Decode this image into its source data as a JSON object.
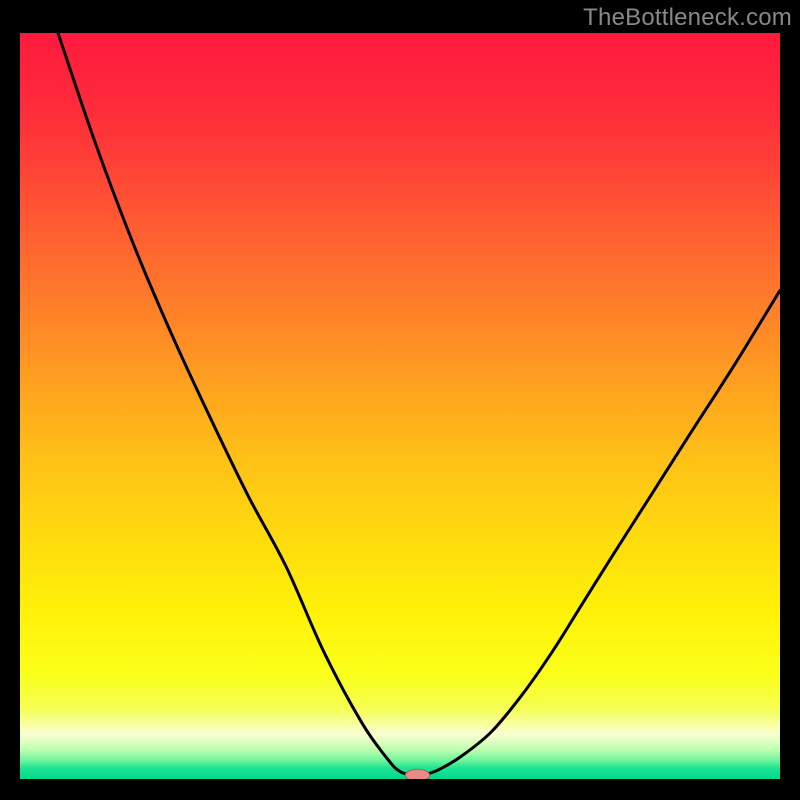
{
  "watermark": "TheBottleneck.com",
  "colors": {
    "gradient": [
      {
        "offset": 0.0,
        "color": "#ff1a3e"
      },
      {
        "offset": 0.1,
        "color": "#ff2b3a"
      },
      {
        "offset": 0.18,
        "color": "#ff4236"
      },
      {
        "offset": 0.28,
        "color": "#ff6330"
      },
      {
        "offset": 0.38,
        "color": "#ff8328"
      },
      {
        "offset": 0.48,
        "color": "#ffa41f"
      },
      {
        "offset": 0.58,
        "color": "#ffc316"
      },
      {
        "offset": 0.68,
        "color": "#ffdc0e"
      },
      {
        "offset": 0.78,
        "color": "#fff208"
      },
      {
        "offset": 0.86,
        "color": "#fbff1a"
      },
      {
        "offset": 0.905,
        "color": "#f5ff52"
      },
      {
        "offset": 0.94,
        "color": "#faffd1"
      },
      {
        "offset": 0.96,
        "color": "#c0ffb0"
      },
      {
        "offset": 0.975,
        "color": "#6ef59d"
      },
      {
        "offset": 0.985,
        "color": "#20e493"
      },
      {
        "offset": 1.0,
        "color": "#00d98c"
      }
    ],
    "curve_stroke": "#000000",
    "marker_fill": "#e88a86",
    "marker_stroke": "#b55a56"
  },
  "chart_data": {
    "type": "line",
    "title": "",
    "xlabel": "",
    "ylabel": "",
    "xlim": [
      0,
      100
    ],
    "ylim": [
      0,
      100
    ],
    "notes": "V-shaped bottleneck curves on a vertical heat gradient (red=high bottleneck at top, green=low at bottom). The minimum (optimal point) is marked with a small pink pill near the bottom center.",
    "series": [
      {
        "name": "left-curve",
        "x": [
          5.0,
          10.0,
          15.0,
          20.0,
          25.0,
          30.0,
          35.0,
          40.0,
          45.0,
          48.5,
          50.0,
          51.5
        ],
        "y": [
          100.0,
          85.0,
          71.5,
          59.5,
          48.5,
          38.0,
          28.5,
          17.0,
          7.5,
          2.5,
          1.0,
          0.5
        ]
      },
      {
        "name": "right-curve",
        "x": [
          53.0,
          55.0,
          58.0,
          62.0,
          66.0,
          70.0,
          74.0,
          78.0,
          83.0,
          88.0,
          94.0,
          100.0
        ],
        "y": [
          0.5,
          1.2,
          3.0,
          6.3,
          11.2,
          17.0,
          23.5,
          30.0,
          38.0,
          46.0,
          55.5,
          65.5
        ]
      }
    ],
    "marker": {
      "x": 52.3,
      "y": 0.5,
      "rx_pct": 1.6,
      "ry_pct": 0.8
    }
  }
}
